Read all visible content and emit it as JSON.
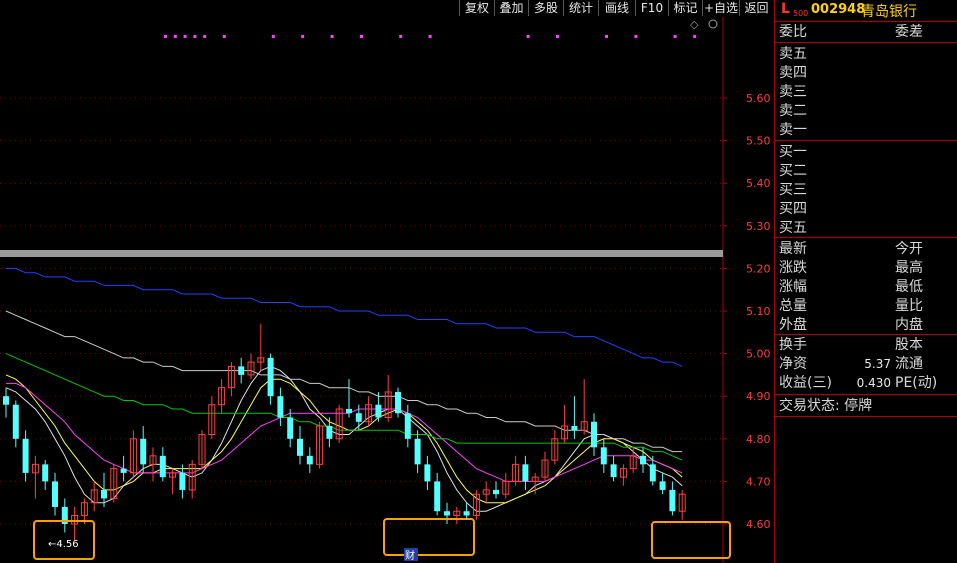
{
  "toolbar": [
    "复权",
    "叠加",
    "多股",
    "统计",
    "画线",
    "F10",
    "标记",
    "+自选",
    "返回"
  ],
  "stock": {
    "logo": "L",
    "logo_sub": "500",
    "code": "002948",
    "name": "青岛银行"
  },
  "order_book": {
    "header_left": "委比",
    "header_right": "委差",
    "sell": [
      "卖五",
      "卖四",
      "卖三",
      "卖二",
      "卖一"
    ],
    "buy": [
      "买一",
      "买二",
      "买三",
      "买四",
      "买五"
    ]
  },
  "quote_rows": [
    {
      "left": "最新",
      "right": "今开"
    },
    {
      "left": "涨跌",
      "right": "最高"
    },
    {
      "left": "涨幅",
      "right": "最低"
    },
    {
      "left": "总量",
      "right": "量比"
    },
    {
      "left": "外盘",
      "right": "内盘"
    }
  ],
  "stats_rows": [
    {
      "left": "换手",
      "value": "",
      "right": "股本"
    },
    {
      "left": "净资",
      "value": "5.37",
      "right": "流通"
    },
    {
      "left": "收益(三)",
      "value": "0.430",
      "right": "PE(动)"
    }
  ],
  "trade_status": "交易状态: 停牌",
  "chart_annotations": {
    "low_label": "←4.56",
    "finance_marker": "财"
  },
  "colors": {
    "up": "#ff4040",
    "down": "#54ffff",
    "ma_white": "#e0e0e0",
    "ma_yellow": "#ffff40",
    "ma_magenta": "#ff40ff",
    "ma_green": "#00c800",
    "ma_blue": "#2040ff",
    "highlight": "#ffa000"
  },
  "chart_data": {
    "type": "candlestick",
    "y_axis": {
      "ticks": [
        5.6,
        5.5,
        5.4,
        5.3,
        5.2,
        5.1,
        5.0,
        4.9,
        4.8,
        4.7,
        4.6
      ],
      "tick_labels": [
        "5.60",
        "5.50",
        "5.40",
        "5.30",
        "5.20",
        "5.10",
        "5.00",
        "4.90",
        "4.80",
        "4.70",
        "4.60"
      ]
    },
    "candles": [
      [
        4.9,
        4.92,
        4.85,
        4.88
      ],
      [
        4.88,
        4.89,
        4.78,
        4.8
      ],
      [
        4.8,
        4.82,
        4.7,
        4.72
      ],
      [
        4.72,
        4.76,
        4.66,
        4.74
      ],
      [
        4.74,
        4.75,
        4.68,
        4.7
      ],
      [
        4.7,
        4.72,
        4.62,
        4.64
      ],
      [
        4.64,
        4.66,
        4.58,
        4.6
      ],
      [
        4.6,
        4.64,
        4.56,
        4.62
      ],
      [
        4.62,
        4.66,
        4.6,
        4.65
      ],
      [
        4.65,
        4.7,
        4.63,
        4.68
      ],
      [
        4.68,
        4.72,
        4.64,
        4.66
      ],
      [
        4.66,
        4.74,
        4.65,
        4.73
      ],
      [
        4.73,
        4.76,
        4.7,
        4.72
      ],
      [
        4.72,
        4.82,
        4.71,
        4.8
      ],
      [
        4.8,
        4.83,
        4.72,
        4.74
      ],
      [
        4.74,
        4.78,
        4.7,
        4.76
      ],
      [
        4.76,
        4.78,
        4.7,
        4.71
      ],
      [
        4.71,
        4.73,
        4.67,
        4.72
      ],
      [
        4.72,
        4.74,
        4.66,
        4.68
      ],
      [
        4.68,
        4.75,
        4.66,
        4.74
      ],
      [
        4.74,
        4.82,
        4.73,
        4.81
      ],
      [
        4.81,
        4.9,
        4.8,
        4.88
      ],
      [
        4.88,
        4.94,
        4.86,
        4.92
      ],
      [
        4.92,
        4.98,
        4.9,
        4.97
      ],
      [
        4.97,
        4.99,
        4.93,
        4.95
      ],
      [
        4.95,
        5.0,
        4.94,
        4.98
      ],
      [
        4.98,
        5.07,
        4.96,
        4.99
      ],
      [
        4.99,
        5.0,
        4.88,
        4.9
      ],
      [
        4.9,
        4.92,
        4.83,
        4.85
      ],
      [
        4.85,
        4.87,
        4.78,
        4.8
      ],
      [
        4.8,
        4.83,
        4.74,
        4.76
      ],
      [
        4.76,
        4.78,
        4.72,
        4.74
      ],
      [
        4.74,
        4.84,
        4.73,
        4.83
      ],
      [
        4.83,
        4.85,
        4.78,
        4.8
      ],
      [
        4.8,
        4.88,
        4.79,
        4.87
      ],
      [
        4.87,
        4.94,
        4.85,
        4.86
      ],
      [
        4.86,
        4.88,
        4.82,
        4.84
      ],
      [
        4.84,
        4.9,
        4.83,
        4.88
      ],
      [
        4.88,
        4.91,
        4.84,
        4.85
      ],
      [
        4.85,
        4.95,
        4.84,
        4.91
      ],
      [
        4.91,
        4.92,
        4.85,
        4.86
      ],
      [
        4.86,
        4.88,
        4.78,
        4.8
      ],
      [
        4.8,
        4.82,
        4.72,
        4.74
      ],
      [
        4.74,
        4.76,
        4.68,
        4.7
      ],
      [
        4.7,
        4.72,
        4.62,
        4.63
      ],
      [
        4.63,
        4.65,
        4.6,
        4.62
      ],
      [
        4.62,
        4.64,
        4.6,
        4.63
      ],
      [
        4.63,
        4.65,
        4.61,
        4.62
      ],
      [
        4.62,
        4.68,
        4.61,
        4.67
      ],
      [
        4.67,
        4.7,
        4.65,
        4.68
      ],
      [
        4.68,
        4.7,
        4.66,
        4.67
      ],
      [
        4.67,
        4.72,
        4.66,
        4.7
      ],
      [
        4.7,
        4.76,
        4.69,
        4.74
      ],
      [
        4.74,
        4.76,
        4.68,
        4.7
      ],
      [
        4.7,
        4.72,
        4.67,
        4.71
      ],
      [
        4.71,
        4.77,
        4.7,
        4.75
      ],
      [
        4.75,
        4.82,
        4.74,
        4.8
      ],
      [
        4.8,
        4.88,
        4.79,
        4.83
      ],
      [
        4.83,
        4.9,
        4.8,
        4.82
      ],
      [
        4.82,
        4.94,
        4.81,
        4.84
      ],
      [
        4.84,
        4.86,
        4.76,
        4.78
      ],
      [
        4.78,
        4.8,
        4.72,
        4.74
      ],
      [
        4.74,
        4.76,
        4.7,
        4.71
      ],
      [
        4.71,
        4.74,
        4.69,
        4.73
      ],
      [
        4.73,
        4.78,
        4.72,
        4.76
      ],
      [
        4.76,
        4.78,
        4.72,
        4.74
      ],
      [
        4.74,
        4.76,
        4.69,
        4.7
      ],
      [
        4.7,
        4.72,
        4.67,
        4.68
      ],
      [
        4.68,
        4.7,
        4.62,
        4.63
      ],
      [
        4.63,
        4.68,
        4.61,
        4.67
      ]
    ],
    "moving_averages": [
      {
        "color": "#e0e0e0",
        "values": [
          4.92,
          4.91,
          4.89,
          4.87,
          4.84,
          4.8,
          4.76,
          4.71,
          4.67,
          4.65,
          4.65,
          4.66,
          4.69,
          4.71,
          4.73,
          4.74,
          4.74,
          4.73,
          4.72,
          4.71,
          4.72,
          4.75,
          4.79,
          4.84,
          4.89,
          4.93,
          4.96,
          4.97,
          4.96,
          4.94,
          4.91,
          4.87,
          4.85,
          4.82,
          4.81,
          4.81,
          4.83,
          4.85,
          4.86,
          4.87,
          4.87,
          4.85,
          4.83,
          4.81,
          4.77,
          4.72,
          4.68,
          4.65,
          4.63,
          4.63,
          4.64,
          4.65,
          4.66,
          4.67,
          4.69,
          4.7,
          4.71,
          4.74,
          4.77,
          4.8,
          4.81,
          4.81,
          4.8,
          4.79,
          4.77,
          4.75,
          4.73,
          4.72,
          4.71,
          4.69
        ]
      },
      {
        "color": "#ffff40",
        "values": [
          4.95,
          4.94,
          4.92,
          4.89,
          4.86,
          4.83,
          4.79,
          4.76,
          4.73,
          4.7,
          4.68,
          4.68,
          4.69,
          4.7,
          4.72,
          4.72,
          4.73,
          4.73,
          4.73,
          4.73,
          4.73,
          4.75,
          4.77,
          4.8,
          4.84,
          4.88,
          4.92,
          4.94,
          4.94,
          4.93,
          4.91,
          4.89,
          4.86,
          4.84,
          4.83,
          4.82,
          4.82,
          4.83,
          4.85,
          4.86,
          4.87,
          4.86,
          4.84,
          4.82,
          4.79,
          4.75,
          4.71,
          4.68,
          4.66,
          4.65,
          4.65,
          4.65,
          4.66,
          4.67,
          4.68,
          4.69,
          4.71,
          4.73,
          4.75,
          4.77,
          4.79,
          4.8,
          4.8,
          4.79,
          4.78,
          4.77,
          4.75,
          4.74,
          4.73,
          4.71
        ]
      },
      {
        "color": "#ff40ff",
        "values": [
          4.93,
          4.93,
          4.92,
          4.9,
          4.88,
          4.86,
          4.84,
          4.81,
          4.79,
          4.77,
          4.75,
          4.74,
          4.73,
          4.72,
          4.72,
          4.72,
          4.72,
          4.72,
          4.72,
          4.72,
          4.73,
          4.74,
          4.75,
          4.77,
          4.79,
          4.81,
          4.83,
          4.84,
          4.85,
          4.86,
          4.86,
          4.86,
          4.86,
          4.86,
          4.86,
          4.86,
          4.87,
          4.87,
          4.87,
          4.87,
          4.87,
          4.86,
          4.85,
          4.83,
          4.81,
          4.79,
          4.77,
          4.75,
          4.73,
          4.72,
          4.71,
          4.7,
          4.7,
          4.7,
          4.7,
          4.7,
          4.71,
          4.72,
          4.73,
          4.74,
          4.75,
          4.76,
          4.76,
          4.76,
          4.76,
          4.75,
          4.75,
          4.74,
          4.73,
          4.72
        ]
      },
      {
        "color": "#00c800",
        "values": [
          5.0,
          4.99,
          4.98,
          4.97,
          4.96,
          4.95,
          4.94,
          4.93,
          4.92,
          4.91,
          4.9,
          4.9,
          4.89,
          4.89,
          4.88,
          4.88,
          4.88,
          4.87,
          4.87,
          4.86,
          4.86,
          4.86,
          4.86,
          4.86,
          4.86,
          4.86,
          4.86,
          4.86,
          4.85,
          4.85,
          4.84,
          4.84,
          4.83,
          4.83,
          4.82,
          4.82,
          4.82,
          4.82,
          4.82,
          4.82,
          4.82,
          4.81,
          4.81,
          4.81,
          4.8,
          4.8,
          4.79,
          4.79,
          4.79,
          4.79,
          4.79,
          4.79,
          4.79,
          4.79,
          4.79,
          4.79,
          4.79,
          4.79,
          4.79,
          4.79,
          4.79,
          4.79,
          4.79,
          4.78,
          4.78,
          4.78,
          4.77,
          4.77,
          4.76,
          4.75
        ]
      },
      {
        "color": "#cccccc",
        "values": [
          5.1,
          5.09,
          5.08,
          5.07,
          5.06,
          5.05,
          5.04,
          5.04,
          5.03,
          5.02,
          5.01,
          5.0,
          4.99,
          4.99,
          4.98,
          4.98,
          4.97,
          4.97,
          4.96,
          4.96,
          4.96,
          4.96,
          4.96,
          4.96,
          4.96,
          4.96,
          4.95,
          4.95,
          4.95,
          4.94,
          4.94,
          4.93,
          4.93,
          4.92,
          4.92,
          4.92,
          4.91,
          4.91,
          4.9,
          4.9,
          4.9,
          4.89,
          4.89,
          4.88,
          4.88,
          4.87,
          4.87,
          4.86,
          4.86,
          4.85,
          4.85,
          4.84,
          4.84,
          4.84,
          4.83,
          4.83,
          4.83,
          4.82,
          4.82,
          4.82,
          4.81,
          4.81,
          4.8,
          4.8,
          4.79,
          4.79,
          4.78,
          4.78,
          4.77,
          4.77
        ]
      },
      {
        "color": "#2040ff",
        "values": [
          5.2,
          5.2,
          5.19,
          5.19,
          5.18,
          5.18,
          5.18,
          5.17,
          5.17,
          5.17,
          5.16,
          5.16,
          5.16,
          5.16,
          5.15,
          5.15,
          5.15,
          5.15,
          5.14,
          5.14,
          5.14,
          5.14,
          5.13,
          5.13,
          5.13,
          5.13,
          5.12,
          5.12,
          5.12,
          5.12,
          5.11,
          5.11,
          5.11,
          5.11,
          5.1,
          5.1,
          5.1,
          5.1,
          5.09,
          5.09,
          5.09,
          5.09,
          5.08,
          5.08,
          5.08,
          5.08,
          5.07,
          5.07,
          5.07,
          5.07,
          5.06,
          5.06,
          5.06,
          5.06,
          5.05,
          5.05,
          5.05,
          5.05,
          5.04,
          5.04,
          5.04,
          5.03,
          5.02,
          5.01,
          5.0,
          4.99,
          4.99,
          4.98,
          4.98,
          4.97
        ]
      }
    ],
    "signal_marker_positions": [
      0,
      1,
      2,
      3,
      4,
      6,
      11,
      14,
      17,
      20,
      24,
      27,
      37,
      40,
      45,
      48,
      52,
      54
    ]
  }
}
